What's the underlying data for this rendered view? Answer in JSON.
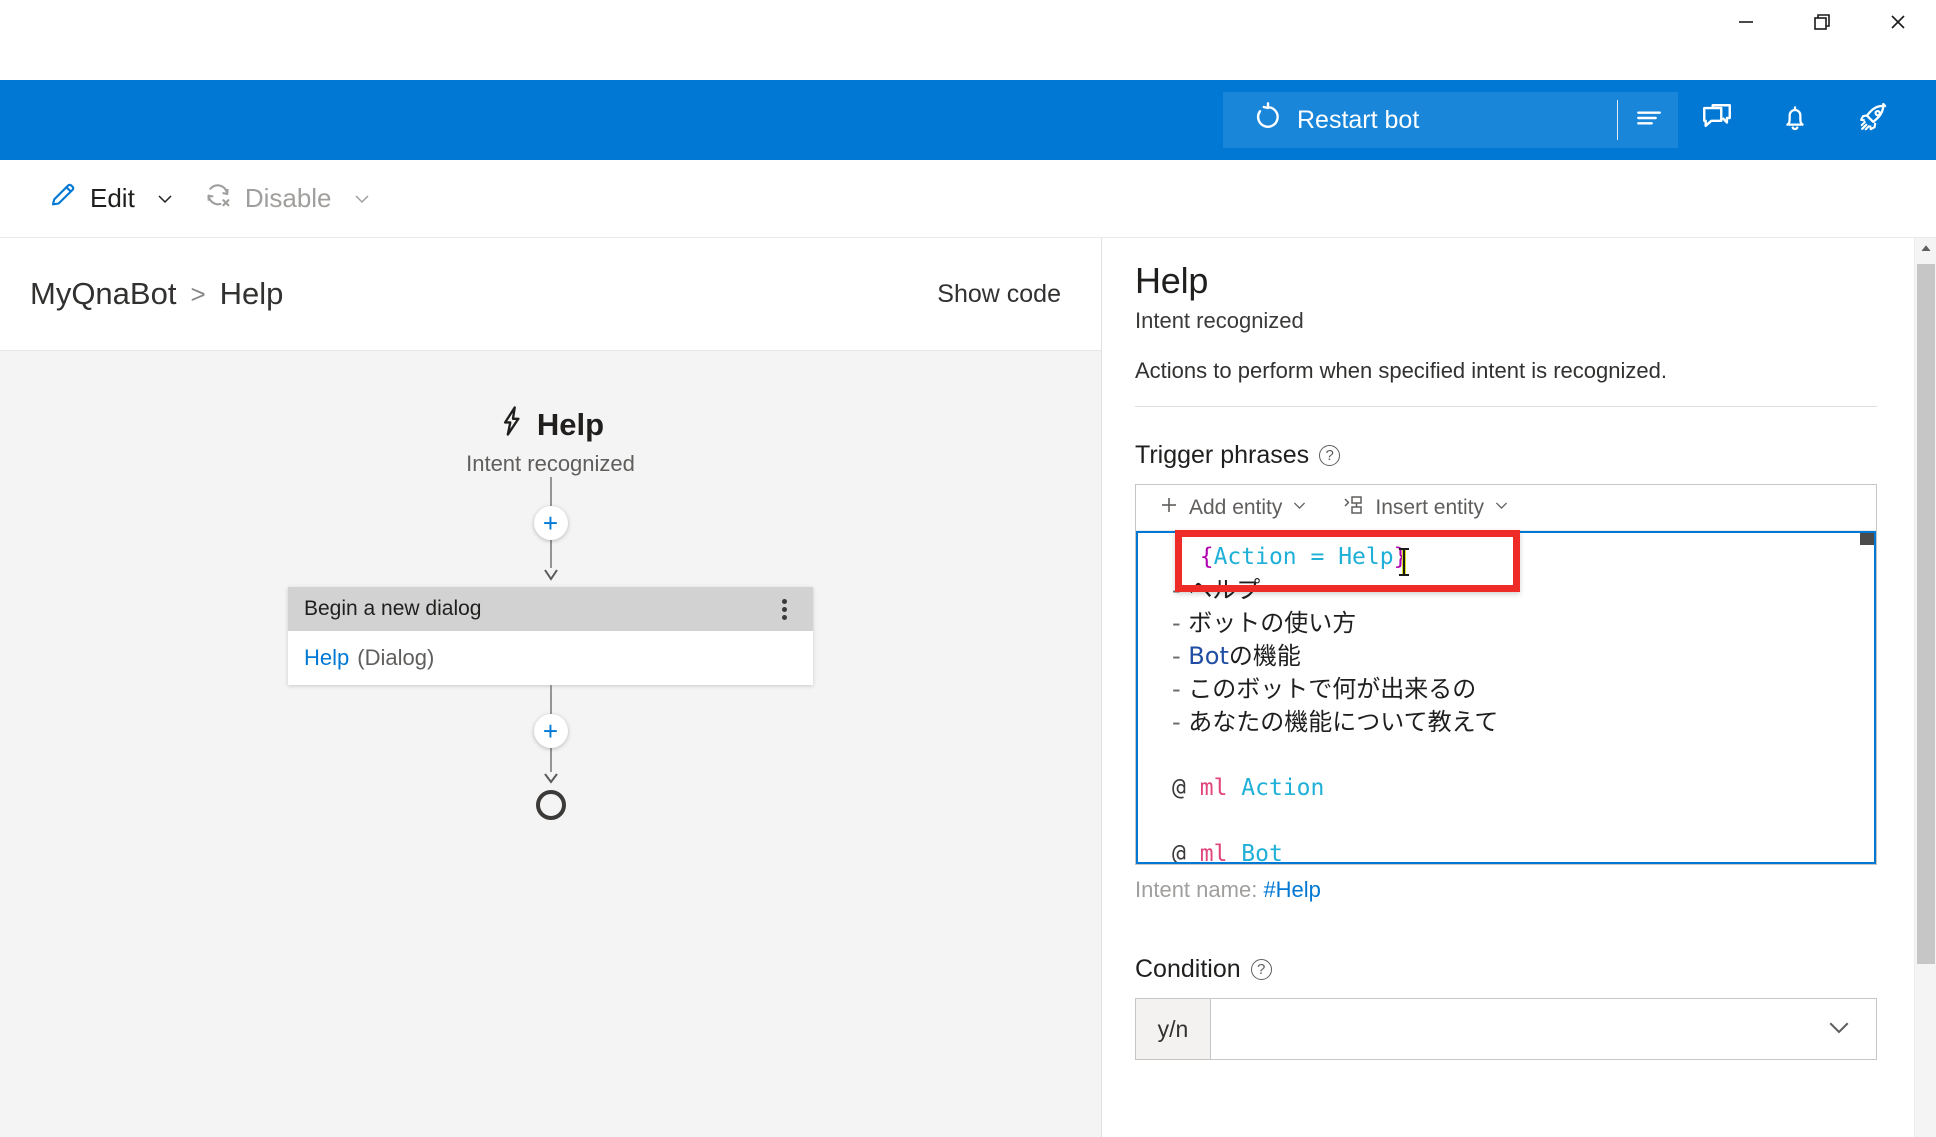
{
  "window": {
    "minimize_label": "Minimize",
    "restore_label": "Restore",
    "close_label": "Close"
  },
  "command_bar": {
    "restart_label": "Restart bot",
    "restart_icon": "restart-icon",
    "list_icon": "list-lines-icon",
    "icons": [
      {
        "name": "chat-bubbles-icon",
        "label": "Test in Emulator"
      },
      {
        "name": "bell-icon",
        "label": "Notifications"
      },
      {
        "name": "rocket-icon",
        "label": "Publish"
      }
    ],
    "accent_color": "#0078d4",
    "restart_button_color": "#1a86da"
  },
  "toolbar": {
    "edit_label": "Edit",
    "edit_icon": "pencil-icon",
    "disable_label": "Disable",
    "disable_icon": "disable-circle-icon",
    "disable_enabled": false
  },
  "breadcrumb": {
    "root": "MyQnaBot",
    "separator": ">",
    "current": "Help",
    "show_code_label": "Show code"
  },
  "flow": {
    "trigger": {
      "icon": "lightning-bolt-icon",
      "title": "Help",
      "subtitle": "Intent recognized"
    },
    "add_node_glyph": "+",
    "card": {
      "header": "Begin a new dialog",
      "menu_icon": "more-vertical-icon",
      "body_name": "Help",
      "body_type": "(Dialog)"
    },
    "end_node": "end-circle"
  },
  "properties": {
    "title": "Help",
    "subtitle": "Intent recognized",
    "description": "Actions to perform when specified intent is recognized.",
    "trigger_phrases": {
      "label": "Trigger phrases",
      "help_glyph": "?",
      "toolbar": {
        "add_entity_label": "Add entity",
        "add_entity_icon": "plus-icon",
        "insert_entity_label": "Insert entity",
        "insert_entity_icon": "insert-entity-icon",
        "caret_icon": "chevron-down-icon"
      },
      "lines": [
        {
          "type": "entity",
          "dash": "-",
          "prefix": "{",
          "inner": "Action = Help",
          "suffix": "}"
        },
        {
          "type": "jp",
          "dash": "-",
          "text": "ヘルプ"
        },
        {
          "type": "jp",
          "dash": "-",
          "text": "ボットの使い方"
        },
        {
          "type": "mixed",
          "dash": "-",
          "latin": "Bot",
          "text": "の機能"
        },
        {
          "type": "jp",
          "dash": "-",
          "text": "このボットで何が出来るの"
        },
        {
          "type": "jp",
          "dash": "-",
          "text": "あなたの機能について教えて"
        },
        {
          "type": "blank",
          "text": ""
        },
        {
          "type": "decl",
          "at": "@",
          "kind": "ml",
          "name": "Action"
        },
        {
          "type": "blank",
          "text": ""
        },
        {
          "type": "decl",
          "at": "@",
          "kind": "ml",
          "name": "Bot"
        }
      ],
      "intent_name_label": "Intent name:",
      "intent_name_value": "#Help",
      "focus_border_color": "#0078d4"
    },
    "condition": {
      "label": "Condition",
      "help_glyph": "?",
      "prefix": "y/n",
      "value": "",
      "placeholder": "",
      "caret_icon": "chevron-down-icon"
    }
  },
  "annotation": {
    "highlight_color": "#ef2b28",
    "target": "first trigger phrase line"
  }
}
